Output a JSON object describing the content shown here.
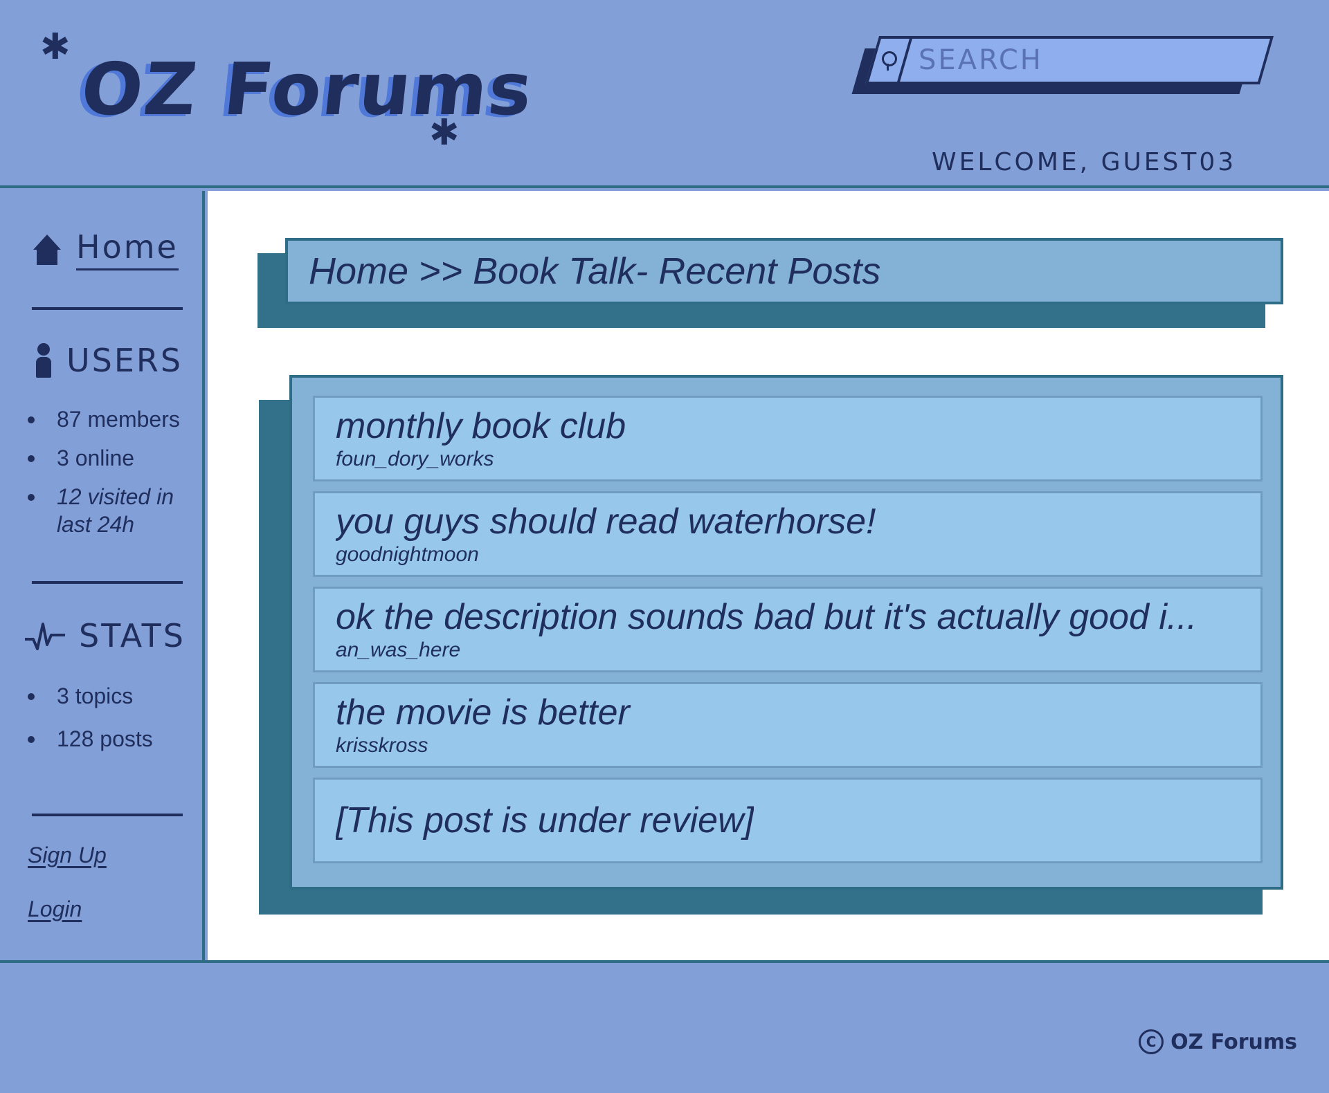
{
  "header": {
    "logo": "OZ Forums",
    "search": {
      "placeholder": "SEARCH"
    },
    "welcome": "WELCOME, GUEST03"
  },
  "sidebar": {
    "home_label": "Home",
    "users": {
      "label": "USERS",
      "items": [
        "87 members",
        "3 online",
        "12 visited in last 24h"
      ]
    },
    "stats": {
      "label": "STATS",
      "items": [
        "3 topics",
        "128 posts"
      ]
    },
    "links": {
      "signup": "Sign Up",
      "login": "Login"
    }
  },
  "main": {
    "breadcrumb": "Home >> Book Talk- Recent Posts",
    "posts": [
      {
        "title": "monthly book club",
        "author": "foun_dory_works"
      },
      {
        "title": "you guys should read waterhorse!",
        "author": "goodnightmoon"
      },
      {
        "title": "ok the description sounds bad but it's actually good i...",
        "author": "an_was_here"
      },
      {
        "title": "the movie is better",
        "author": "krisskross"
      },
      {
        "title": "[This post is under review]",
        "author": ""
      }
    ]
  },
  "footer": {
    "copyright_symbol": "C",
    "copyright": "OZ Forums"
  },
  "colors": {
    "background": "#829fd8",
    "ink": "#1f2e5c",
    "panel": "#84b1d6",
    "post": "#97c8ec",
    "shadow": "#33708a"
  },
  "icons": [
    "star-icon",
    "search-icon",
    "home-icon",
    "user-icon",
    "pulse-icon",
    "copyright-icon"
  ]
}
